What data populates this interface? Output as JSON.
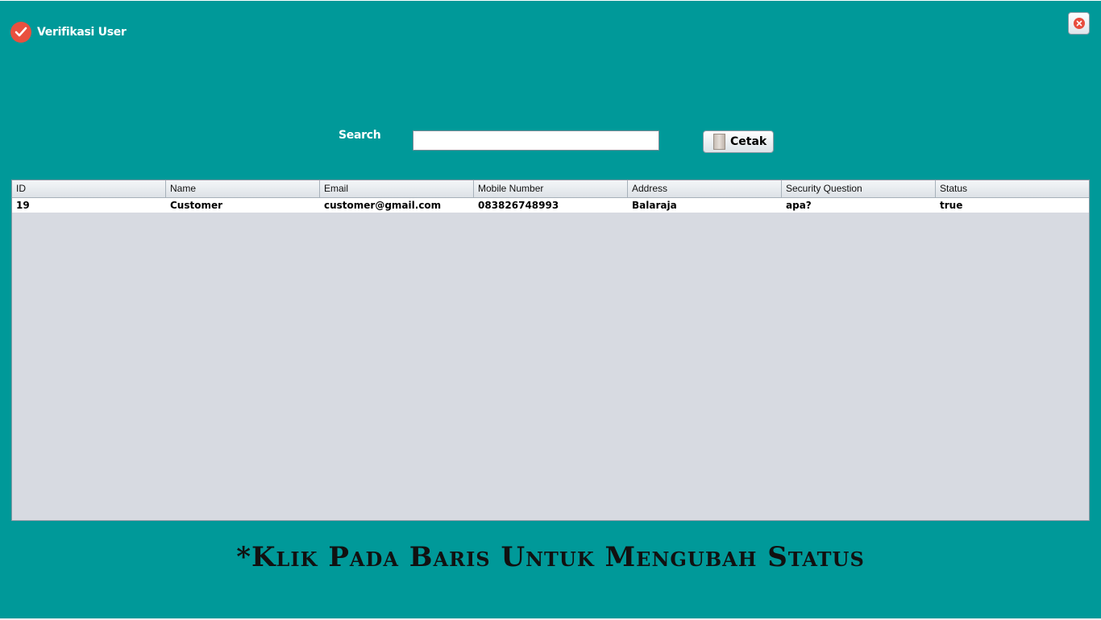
{
  "window": {
    "title": "Verifikasi User",
    "icons": {
      "title_icon": "check-circle-icon",
      "close_icon": "close-icon"
    },
    "colors": {
      "background": "#009999",
      "accent": "#e9503f"
    }
  },
  "toolbar": {
    "search_label": "Search",
    "search_value": "",
    "print_label": "Cetak",
    "print_icon": "printer-icon"
  },
  "table": {
    "columns": [
      "ID",
      "Name",
      "Email",
      "Mobile Number",
      "Address",
      "Security Question",
      "Status"
    ],
    "rows": [
      [
        "19",
        "Customer",
        "customer@gmail.com",
        "083826748993",
        "Balaraja",
        "apa?",
        "true"
      ]
    ]
  },
  "footer": {
    "instruction": "*Klik Pada Baris Untuk Mengubah Status"
  }
}
